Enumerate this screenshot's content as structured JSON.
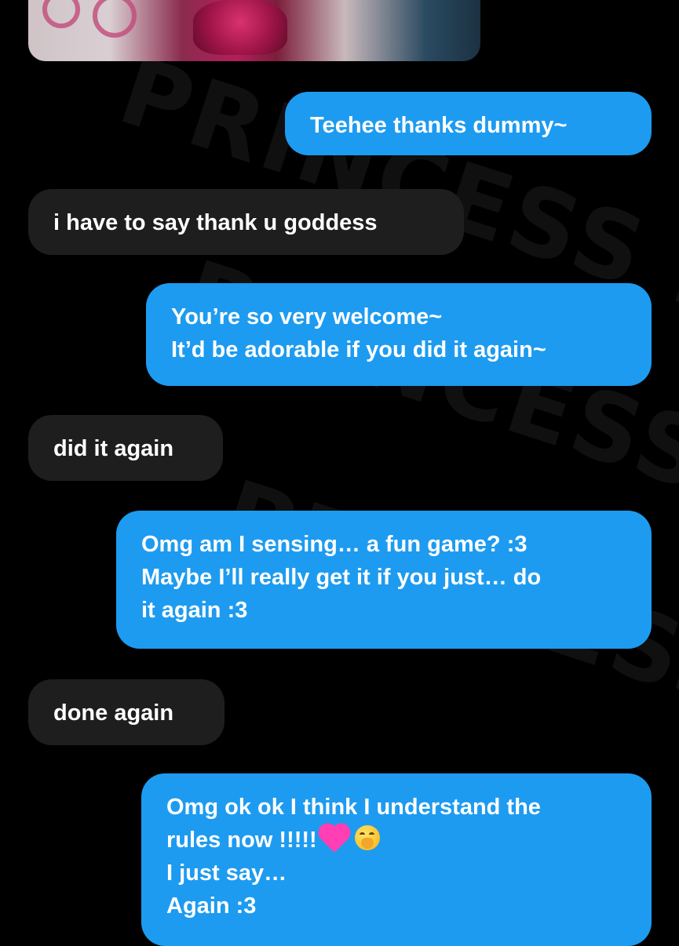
{
  "colors": {
    "background": "#000000",
    "sent_bubble": "#1d9bf0",
    "received_bubble": "#1e1e1e",
    "text": "#ffffff"
  },
  "watermark": "PRINCESS PIXEL",
  "messages": [
    {
      "direction": "sent",
      "lines": [
        "Teehee thanks dummy~"
      ]
    },
    {
      "direction": "received",
      "lines": [
        "i have to say thank u goddess"
      ]
    },
    {
      "direction": "sent",
      "lines": [
        "You’re so very welcome~",
        "It’d be adorable if you did it again~"
      ]
    },
    {
      "direction": "received",
      "lines": [
        "did it again"
      ]
    },
    {
      "direction": "sent",
      "lines": [
        "Omg am I sensing… a fun game? :3",
        "Maybe I’ll really get it if you just… do",
        "it again :3"
      ]
    },
    {
      "direction": "received",
      "lines": [
        "done again"
      ]
    },
    {
      "direction": "sent",
      "lines": [
        "Omg ok ok I think I understand the",
        "rules now !!!!!",
        "I just say…",
        "Again :3"
      ],
      "emoji": [
        "pink-heart-icon",
        "face-with-hand-over-mouth-icon"
      ]
    }
  ]
}
